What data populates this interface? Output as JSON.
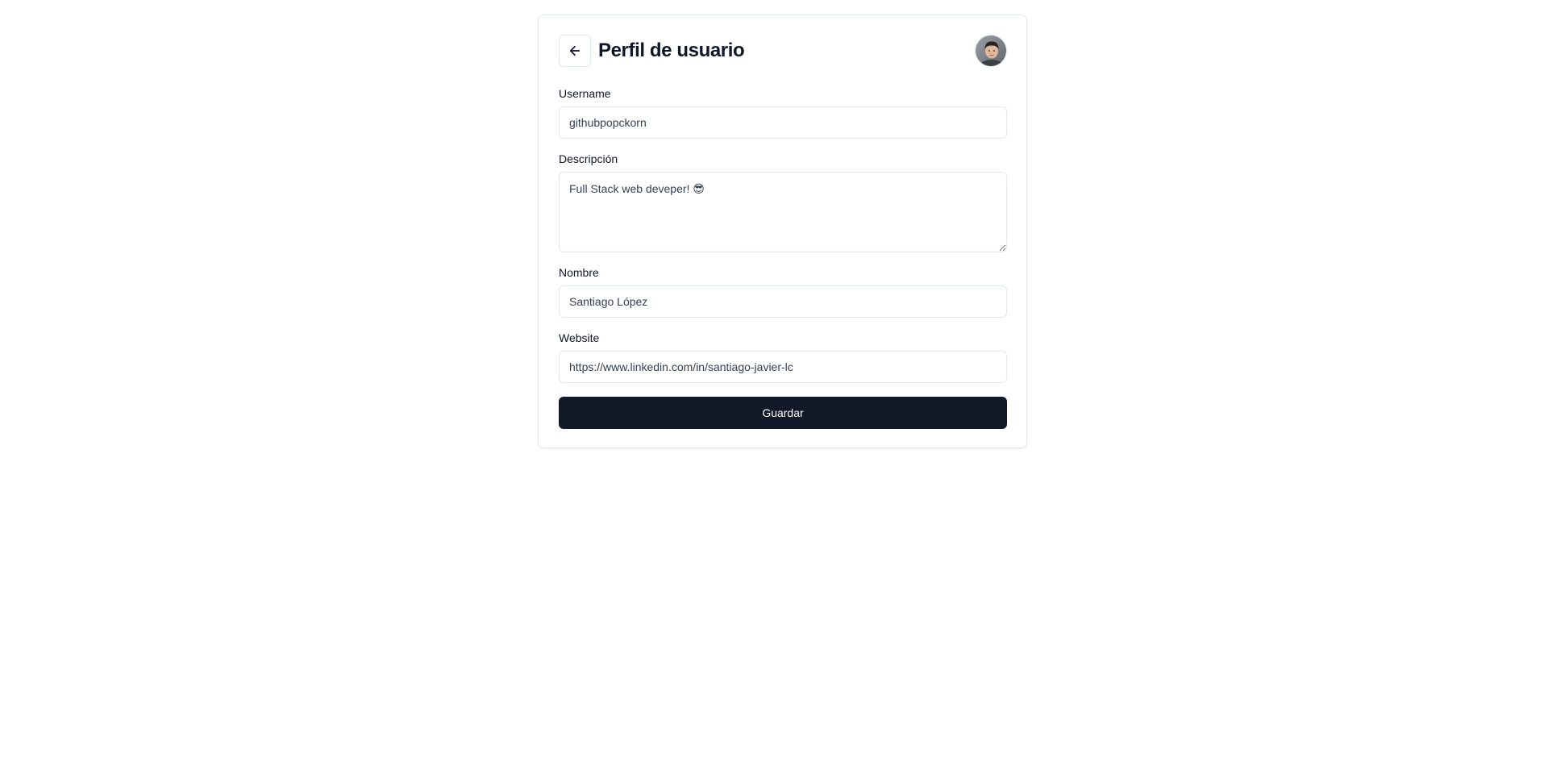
{
  "header": {
    "title": "Perfil de usuario",
    "back_icon": "arrow-left-icon",
    "avatar_alt": "profile photo"
  },
  "form": {
    "username": {
      "label": "Username",
      "value": "githubpopckorn"
    },
    "description": {
      "label": "Descripción",
      "value": "Full Stack web deveper! 😎"
    },
    "name": {
      "label": "Nombre",
      "value": "Santiago López"
    },
    "website": {
      "label": "Website",
      "value": "https://www.linkedin.com/in/santiago-javier-lc"
    },
    "save_label": "Guardar"
  },
  "colors": {
    "primary_button": "#111827",
    "border": "#e2e8f0",
    "text": "#0f172a"
  }
}
